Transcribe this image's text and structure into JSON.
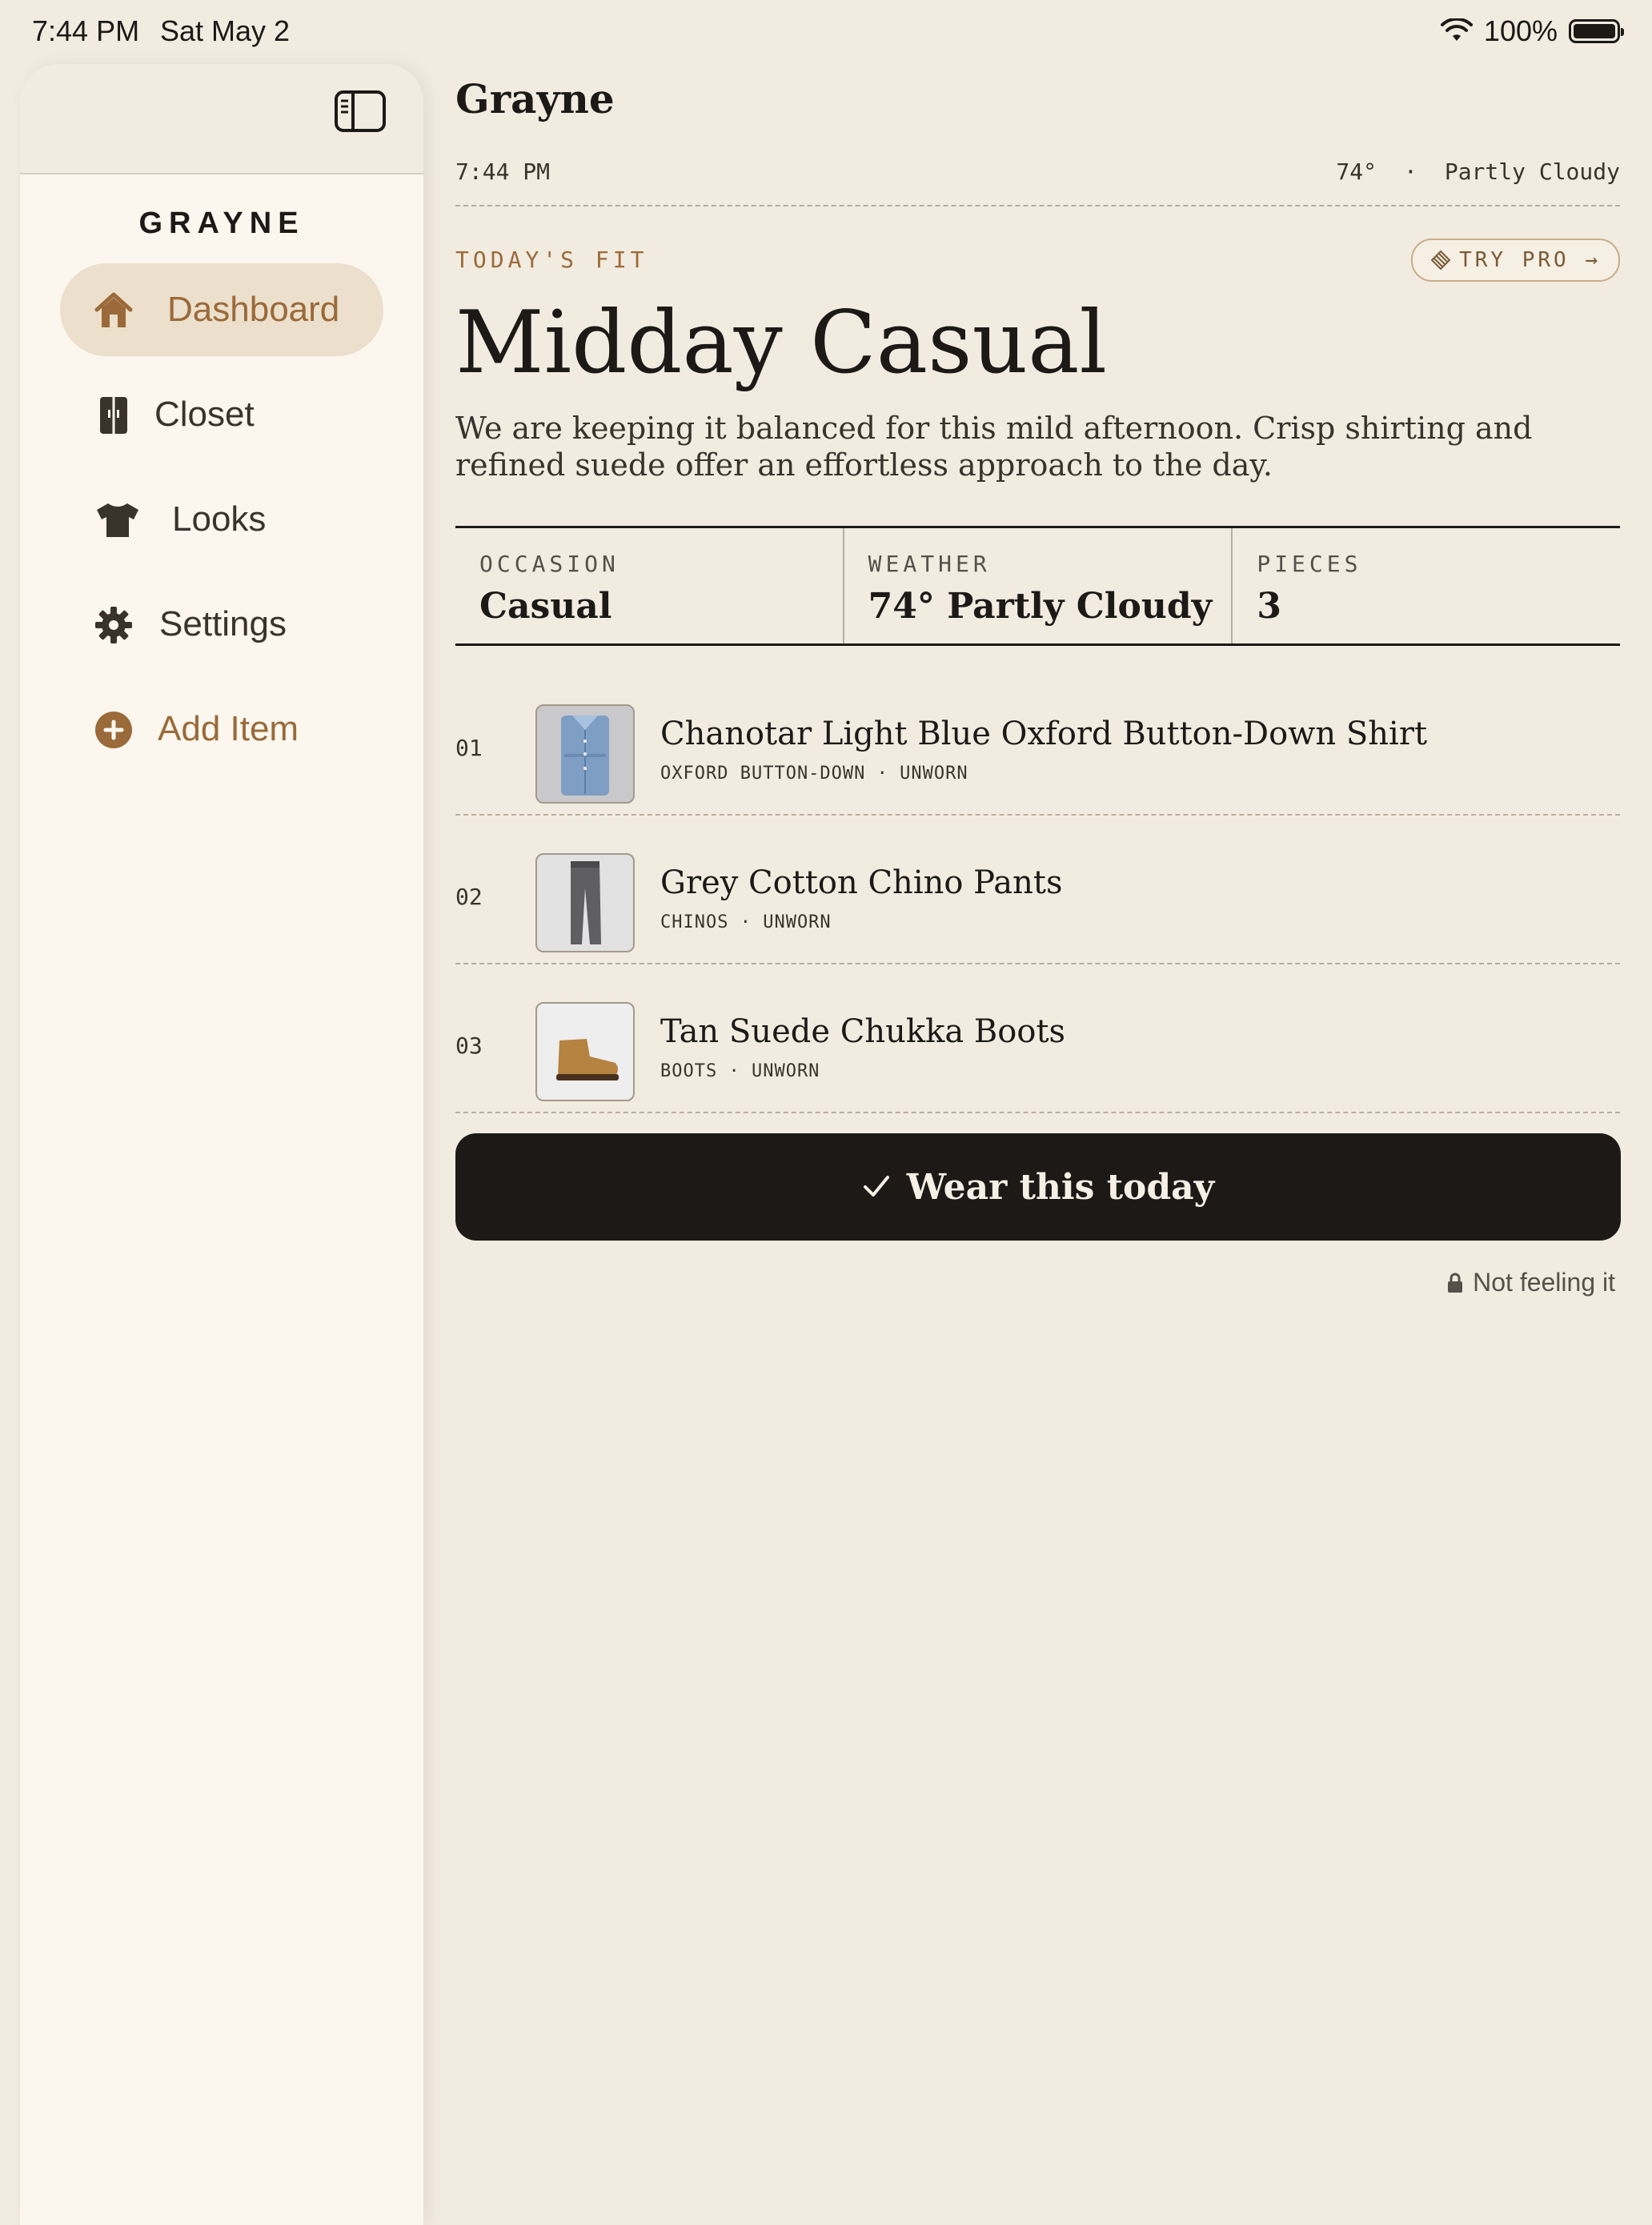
{
  "status_bar": {
    "time": "7:44 PM",
    "date": "Sat May 2",
    "battery": "100%",
    "battery_level": 1.0
  },
  "sidebar": {
    "brand": "GRAYNE",
    "items": [
      {
        "label": "Dashboard",
        "icon": "house-icon",
        "active": true
      },
      {
        "label": "Closet",
        "icon": "wardrobe-icon"
      },
      {
        "label": "Looks",
        "icon": "tshirt-icon"
      },
      {
        "label": "Settings",
        "icon": "gear-icon"
      },
      {
        "label": "Add Item",
        "icon": "plus-circle-icon"
      }
    ]
  },
  "header": {
    "title": "Grayne",
    "time": "7:44 PM",
    "temperature": "74°",
    "separator": "·",
    "condition": "Partly Cloudy"
  },
  "fit": {
    "eyebrow": "TODAY'S FIT",
    "pro_label": "TRY PRO →",
    "headline": "Midday Casual",
    "summary": "We are keeping it balanced for this mild afternoon. Crisp shirting and refined suede offer an effortless approach to the day."
  },
  "stats": [
    {
      "label": "OCCASION",
      "value": "Casual"
    },
    {
      "label": "WEATHER",
      "value": "74° Partly Cloudy"
    },
    {
      "label": "PIECES",
      "value": "3"
    }
  ],
  "items": [
    {
      "num": "01",
      "name": "Chanotar Light Blue Oxford Button-Down Shirt",
      "tags": "OXFORD BUTTON-DOWN · UNWORN"
    },
    {
      "num": "02",
      "name": "Grey Cotton Chino Pants",
      "tags": "CHINOS · UNWORN"
    },
    {
      "num": "03",
      "name": "Tan Suede Chukka Boots",
      "tags": "BOOTS · UNWORN"
    }
  ],
  "actions": {
    "wear_label": "Wear this today",
    "skip_label": "Not feeling it"
  },
  "colors": {
    "accent": "#9a6a3a",
    "background": "#f2ebe0",
    "sidebar": "#fbf7ee",
    "button": "#1c1917"
  }
}
